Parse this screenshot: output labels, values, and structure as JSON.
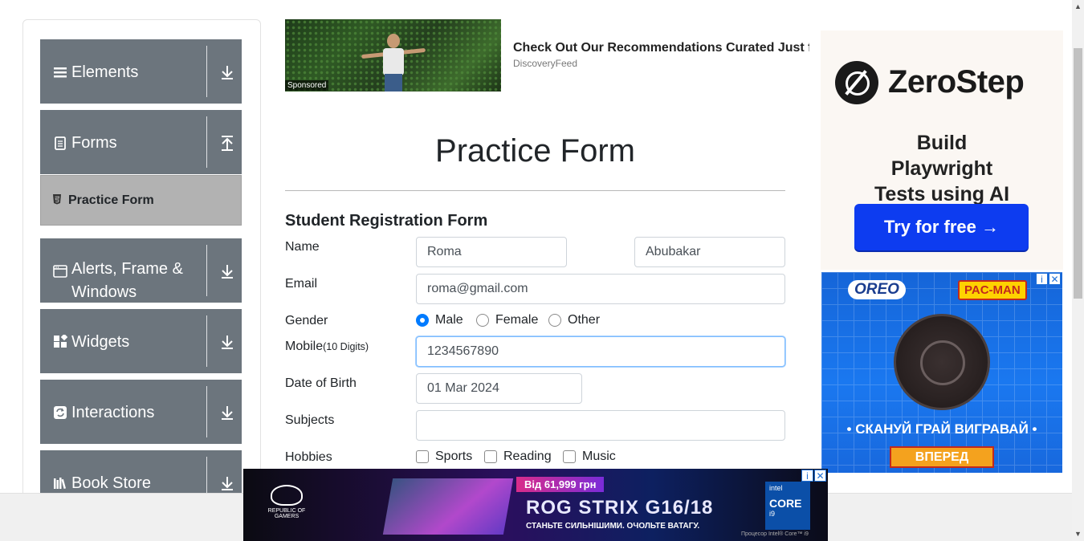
{
  "sidebar": {
    "groups": [
      {
        "label": "Elements",
        "icon": "list-icon",
        "arrow": "download"
      },
      {
        "label": "Forms",
        "icon": "document-icon",
        "arrow": "upload"
      },
      {
        "label": "Alerts, Frame & Windows",
        "icon": "window-icon",
        "arrow": "download"
      },
      {
        "label": "Widgets",
        "icon": "widgets-icon",
        "arrow": "download"
      },
      {
        "label": "Interactions",
        "icon": "interactions-icon",
        "arrow": "download"
      },
      {
        "label": "Book Store",
        "icon": "books-icon",
        "arrow": "download"
      }
    ],
    "active_item": "Practice Form"
  },
  "top_ad": {
    "tag": "Sponsored",
    "headline": "Check Out Our Recommendations Curated Just for You",
    "source": "DiscoveryFeed"
  },
  "form": {
    "title": "Practice Form",
    "subtitle": "Student Registration Form",
    "name_label": "Name",
    "first_name": "Roma",
    "last_name": "Abubakar",
    "email_label": "Email",
    "email": "roma@gmail.com",
    "gender_label": "Gender",
    "gender_options": [
      "Male",
      "Female",
      "Other"
    ],
    "gender_selected": "Male",
    "mobile_label": "Mobile",
    "mobile_hint": "(10 Digits)",
    "mobile": "1234567890",
    "dob_label": "Date of Birth",
    "dob": "01 Mar 2024",
    "subjects_label": "Subjects",
    "subjects": "",
    "hobbies_label": "Hobbies",
    "hobbies": [
      "Sports",
      "Reading",
      "Music"
    ]
  },
  "zerostep_ad": {
    "brand": "ZeroStep",
    "tagline": "Build Playwright Tests using AI",
    "cta": "Try for free →"
  },
  "oreo_ad": {
    "brand": "OREO",
    "partner": "PAC-MAN",
    "text": "• СКАНУЙ ГРАЙ ВИГРАВАЙ •",
    "cta": "ВПЕРЕД"
  },
  "rog_ad": {
    "brand": "REPUBLIC OF GAMERS",
    "price": "Від 61,999 грн",
    "title": "ROG STRIX G16/18",
    "slogan": "СТАНЬТЕ СИЛЬНІШИМИ. ОЧОЛЬТЕ ВАТАГУ.",
    "badge_top": "intel",
    "badge_core": "CORE",
    "badge_tier": "i9",
    "note": "Процесор Intel® Core™ i9"
  },
  "colors": {
    "sidebar_group": "#6c757d",
    "active_item": "#b2b2b2",
    "accent": "#007bff"
  }
}
